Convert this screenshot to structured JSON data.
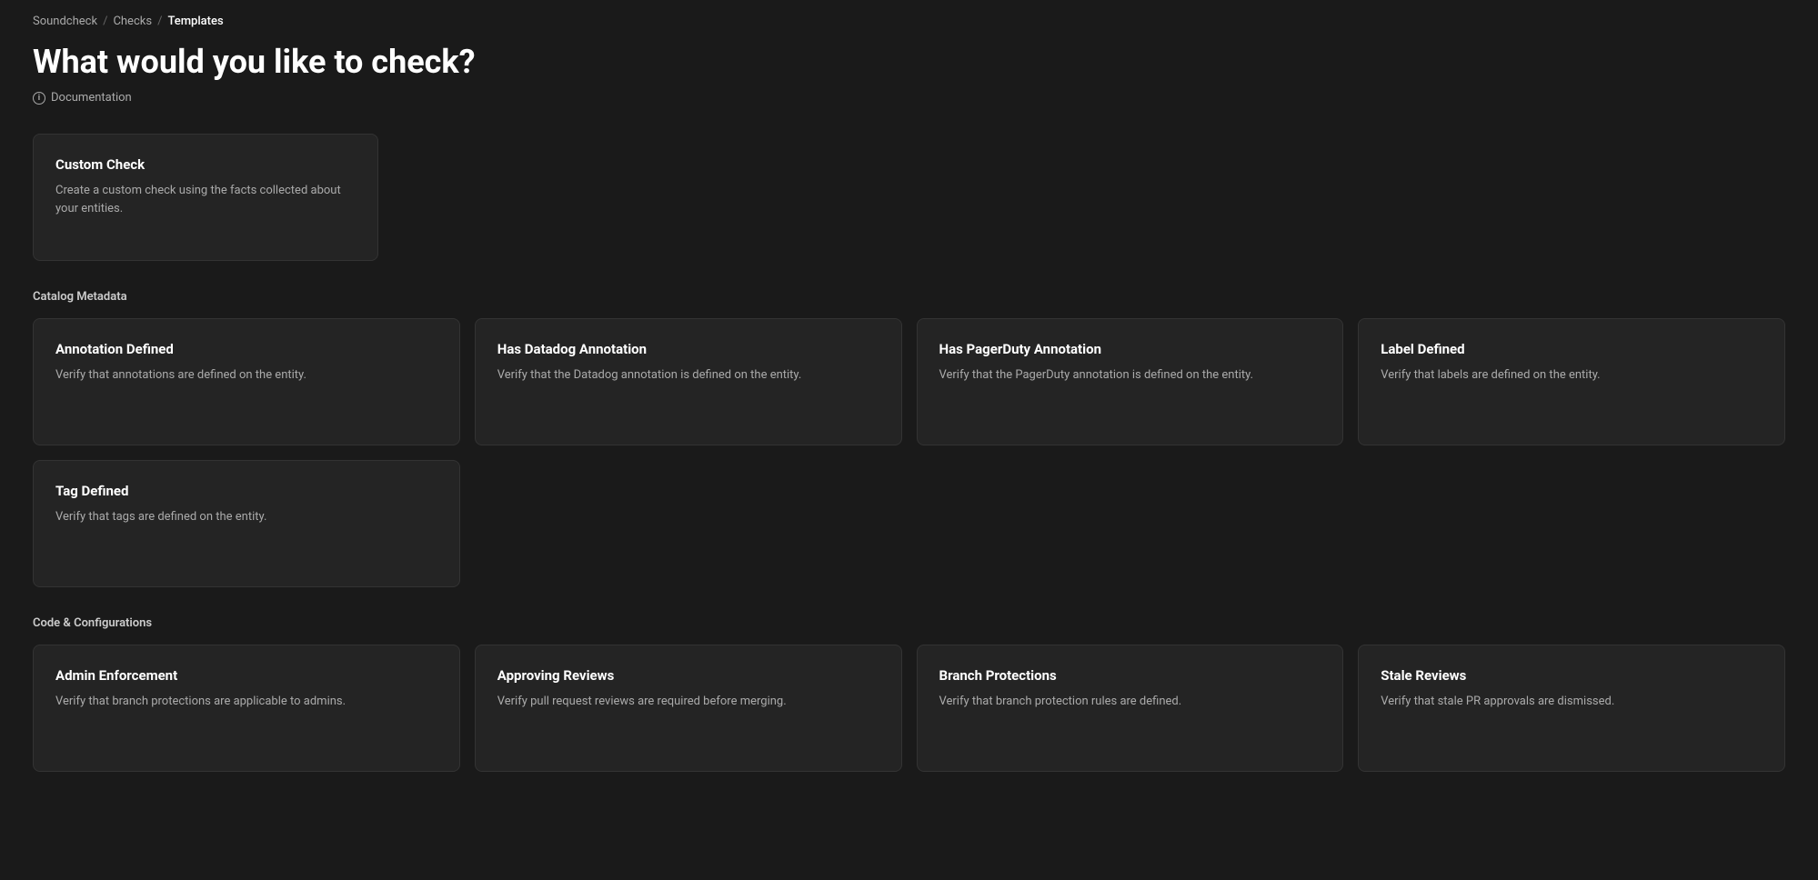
{
  "breadcrumb": {
    "items": [
      {
        "label": "Soundcheck",
        "link": true
      },
      {
        "label": "Checks",
        "link": true
      },
      {
        "label": "Templates",
        "link": false
      }
    ],
    "separator": "/"
  },
  "page": {
    "title": "What would you like to check?",
    "documentation_label": "Documentation"
  },
  "custom_check": {
    "title": "Custom Check",
    "description": "Create a custom check using the facts collected about your entities."
  },
  "sections": [
    {
      "id": "catalog-metadata",
      "label": "Catalog Metadata",
      "cards": [
        {
          "id": "annotation-defined",
          "title": "Annotation Defined",
          "description": "Verify that annotations are defined on the entity."
        },
        {
          "id": "has-datadog-annotation",
          "title": "Has Datadog Annotation",
          "description": "Verify that the Datadog annotation is defined on the entity."
        },
        {
          "id": "has-pagerduty-annotation",
          "title": "Has PagerDuty Annotation",
          "description": "Verify that the PagerDuty annotation is defined on the entity."
        },
        {
          "id": "label-defined",
          "title": "Label Defined",
          "description": "Verify that labels are defined on the entity."
        }
      ]
    },
    {
      "id": "catalog-metadata-row2",
      "label": "",
      "cards": [
        {
          "id": "tag-defined",
          "title": "Tag Defined",
          "description": "Verify that tags are defined on the entity."
        }
      ]
    },
    {
      "id": "code-configurations",
      "label": "Code & Configurations",
      "cards": [
        {
          "id": "admin-enforcement",
          "title": "Admin Enforcement",
          "description": "Verify that branch protections are applicable to admins."
        },
        {
          "id": "approving-reviews",
          "title": "Approving Reviews",
          "description": "Verify pull request reviews are required before merging."
        },
        {
          "id": "branch-protections",
          "title": "Branch Protections",
          "description": "Verify that branch protection rules are defined."
        },
        {
          "id": "stale-reviews",
          "title": "Stale Reviews",
          "description": "Verify that stale PR approvals are dismissed."
        }
      ]
    }
  ]
}
